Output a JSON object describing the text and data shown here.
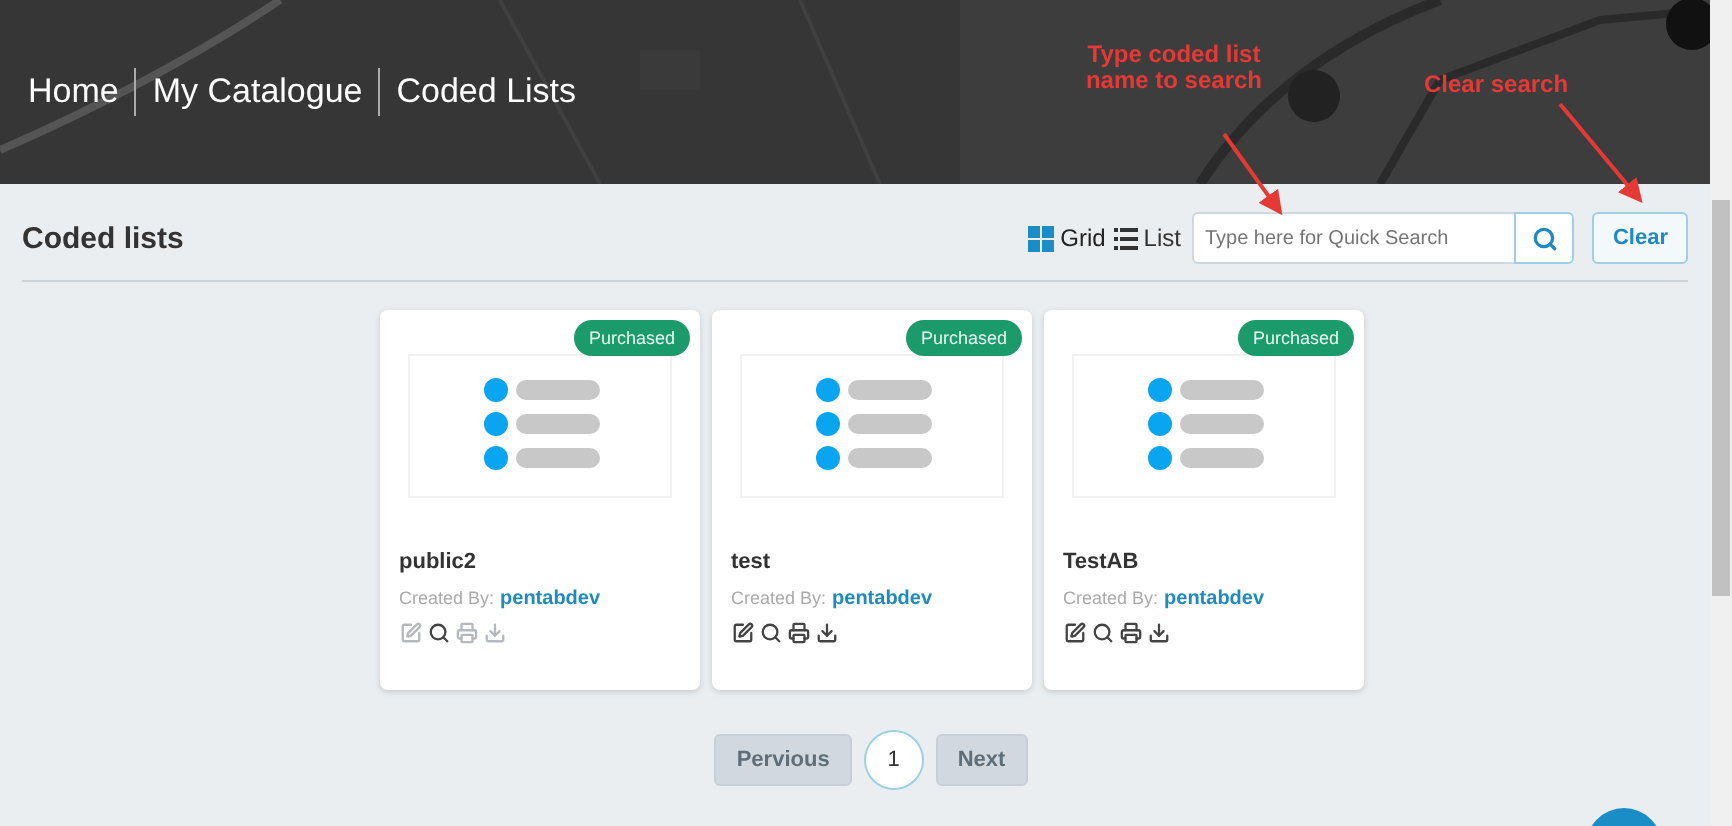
{
  "breadcrumb": [
    {
      "label": "Home"
    },
    {
      "label": "My Catalogue"
    },
    {
      "label": "Coded Lists"
    }
  ],
  "annotations": [
    {
      "text": "Type coded list name to search"
    },
    {
      "text": "Clear search"
    }
  ],
  "page_title": "Coded lists",
  "view_toggle": [
    {
      "label": "Grid",
      "selected": true
    },
    {
      "label": "List",
      "selected": false
    }
  ],
  "search": {
    "placeholder": "Type here for Quick Search"
  },
  "clear_button": "Clear",
  "cards": [
    {
      "badge": "Purchased",
      "name": "public2",
      "created_by_label": "Created By:",
      "author": "pentabdev",
      "actions_disabled": true
    },
    {
      "badge": "Purchased",
      "name": "test",
      "created_by_label": "Created By:",
      "author": "pentabdev",
      "actions_disabled": false
    },
    {
      "badge": "Purchased",
      "name": "TestAB",
      "created_by_label": "Created By:",
      "author": "pentabdev",
      "actions_disabled": false
    }
  ],
  "pagination": {
    "previous": "Pervious",
    "pages": [
      {
        "label": "1",
        "selected": true
      }
    ],
    "next": "Next"
  }
}
